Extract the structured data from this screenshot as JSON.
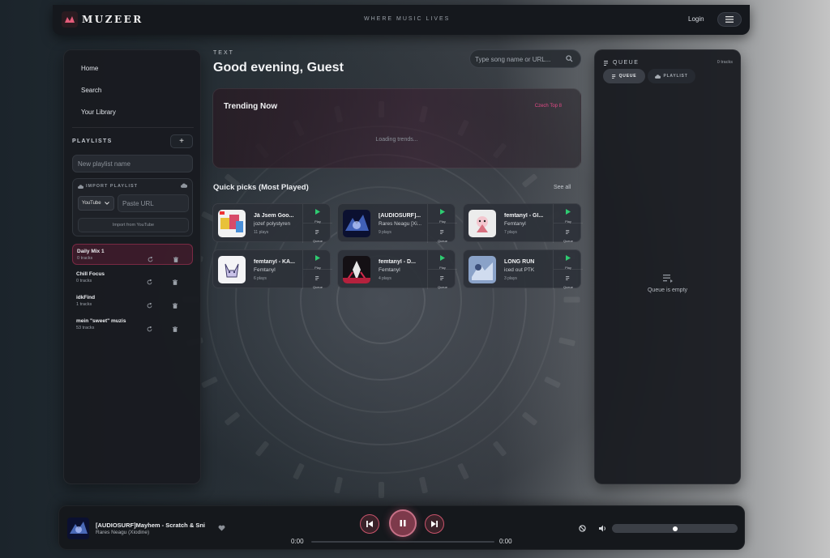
{
  "header": {
    "brand": "MUZEER",
    "tagline": "WHERE MUSIC LIVES",
    "login_label": "Login",
    "menu_icon": "hamburger-icon"
  },
  "sidebar": {
    "nav": [
      {
        "label": "Home"
      },
      {
        "label": "Search"
      },
      {
        "label": "Your Library"
      }
    ],
    "playlists_title": "PLAYLISTS",
    "add_label": "+",
    "new_playlist_placeholder": "New playlist name",
    "import": {
      "title": "IMPORT PLAYLIST",
      "source_selected": "YouTube",
      "url_placeholder": "Paste URL",
      "button_label": "Import from YouTube"
    },
    "playlists": [
      {
        "name": "Daily Mix 1",
        "count": "0 tracks",
        "active": true
      },
      {
        "name": "Chill Focus",
        "count": "0 tracks",
        "active": false
      },
      {
        "name": "idkFind",
        "count": "1 tracks",
        "active": false
      },
      {
        "name": "mein \"sweet\" muzis",
        "count": "53 tracks",
        "active": false
      }
    ]
  },
  "main": {
    "kicker": "TEXT",
    "greeting": "Good evening, Guest",
    "search_placeholder": "Type song name or URL...",
    "trending": {
      "title": "Trending Now",
      "link": "Czech Top 8",
      "loading": "Loading trends..."
    },
    "quick_picks": {
      "title": "Quick picks (Most Played)",
      "see_all": "See all",
      "play_label": "Play",
      "queue_label": "Queue",
      "items": [
        {
          "title": "Já Jsem Goo...",
          "artist": "jozef polystyren",
          "plays": "11 plays"
        },
        {
          "title": "[AUDIOSURF]...",
          "artist": "Rares Neagu [Xi...",
          "plays": "9 plays"
        },
        {
          "title": "femtanyl - Gl...",
          "artist": "Femtanyl",
          "plays": "7 plays"
        },
        {
          "title": "femtanyl - KA...",
          "artist": "Femtanyl",
          "plays": "6 plays"
        },
        {
          "title": "femtanyl - D...",
          "artist": "Femtanyl",
          "plays": "4 plays"
        },
        {
          "title": "LONG RUN",
          "artist": "iced out PTK",
          "plays": "3 plays"
        }
      ]
    }
  },
  "queue": {
    "title": "QUEUE",
    "count": "0 tracks",
    "tab_queue": "QUEUE",
    "tab_playlist": "PLAYLIST",
    "empty_text": "Queue is empty"
  },
  "player": {
    "title": "[AUDIOSURF]Mayhem - Scratch & Sni",
    "artist": "Rares Neagu (Xiodine)",
    "current_time": "0:00",
    "duration": "0:00",
    "progress": 0,
    "volume": 0.5
  },
  "colors": {
    "accent": "#c9536b",
    "link": "#e24a86",
    "play_green": "#2ecc71"
  }
}
